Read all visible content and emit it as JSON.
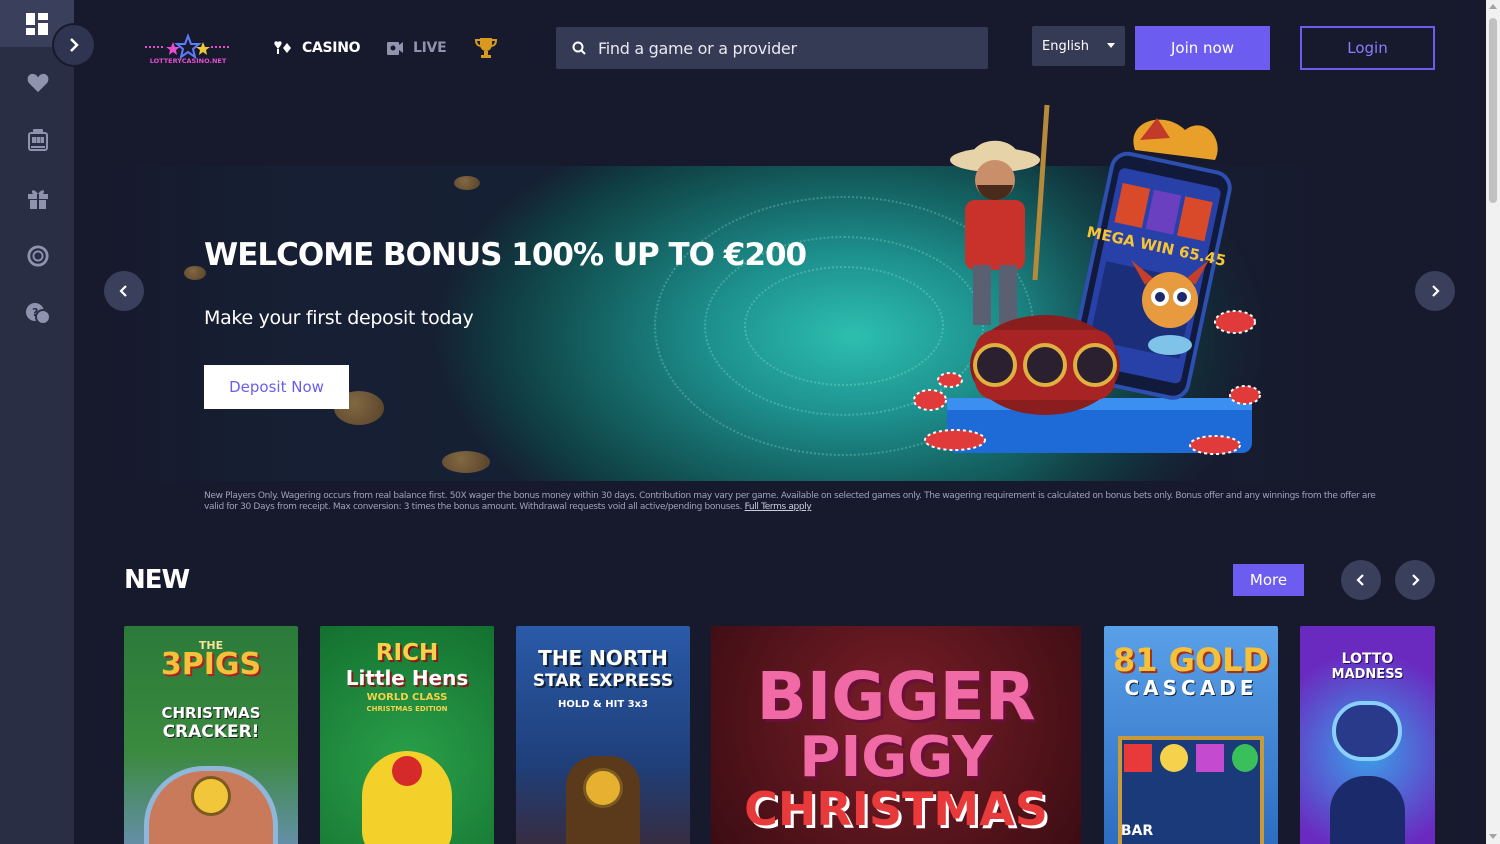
{
  "logo": {
    "text": "LOTTERYCASINO.NET"
  },
  "sidebar": {
    "items": [
      {
        "icon": "dashboard-icon"
      },
      {
        "icon": "heart-icon"
      },
      {
        "icon": "slot-machine-icon"
      },
      {
        "icon": "gift-icon"
      },
      {
        "icon": "lifebuoy-icon"
      },
      {
        "icon": "support-chat-icon"
      }
    ]
  },
  "nav": {
    "casino": "CASINO",
    "live": "LIVE"
  },
  "search": {
    "placeholder": "Find a game or a provider"
  },
  "language": {
    "selected": "English"
  },
  "header": {
    "join_label": "Join now",
    "login_label": "Login"
  },
  "banner": {
    "title": "WELCOME BONUS 100% UP TO €200",
    "subtitle": "Make your first deposit today",
    "cta_label": "Deposit Now",
    "slot_text": "MEGA WIN 65.45"
  },
  "terms": {
    "text": "New Players Only. Wagering occurs from real balance first. 50X wager the bonus money within 30 days. Contribution may vary per game. Available on selected games only. The wagering requirement is calculated on bonus bets only. Bonus offer and any winnings from the offer are valid for 30 Days from receipt. Max conversion: 3 times the bonus amount. Withdrawal requests void all active/pending bonuses.",
    "link": "Full Terms apply"
  },
  "new_section": {
    "title": "NEW",
    "more_label": "More",
    "games": [
      {
        "line1": "THE",
        "line2": "3PIGS",
        "line3": "CHRISTMAS",
        "line4": "CRACKER!"
      },
      {
        "line1": "RICH",
        "line2": "Little Hens",
        "line3": "WORLD CLASS",
        "line4": "CHRISTMAS EDITION"
      },
      {
        "line1": "THE NORTH",
        "line2": "STAR EXPRESS",
        "line3": "HOLD & HIT 3x3"
      },
      {
        "line1": "BIGGER",
        "line2": "PIGGY",
        "line3": "CHRISTMAS"
      },
      {
        "line1": "81 GOLD",
        "line2": "CASCADE",
        "line3": "BAR"
      },
      {
        "line1": "LOTTO",
        "line2": "MADNESS"
      }
    ]
  },
  "colors": {
    "accent": "#6c5df0",
    "background": "#171a2d",
    "sidebar": "#2a2e45"
  }
}
